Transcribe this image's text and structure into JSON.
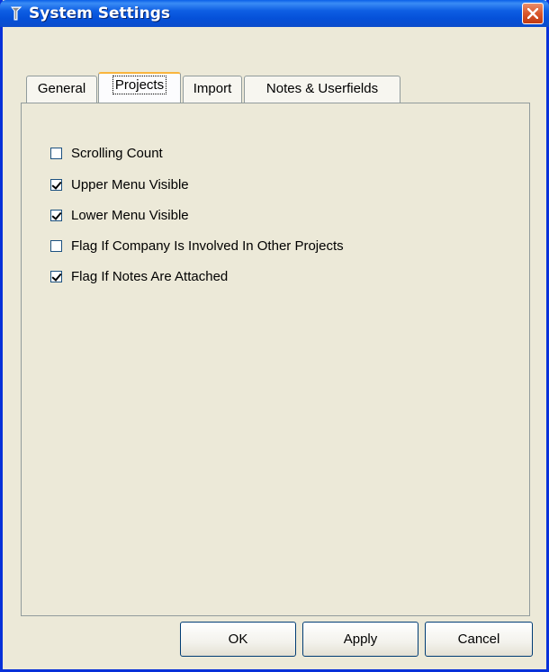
{
  "window": {
    "title": "System Settings"
  },
  "tabs": [
    {
      "label": "General",
      "active": false
    },
    {
      "label": "Projects",
      "active": true
    },
    {
      "label": "Import",
      "active": false
    },
    {
      "label": "Notes & Userfields",
      "active": false
    }
  ],
  "options": [
    {
      "label": "Scrolling Count",
      "checked": false
    },
    {
      "label": "Upper Menu Visible",
      "checked": true
    },
    {
      "label": "Lower Menu Visible",
      "checked": true
    },
    {
      "label": "Flag If Company Is Involved In Other Projects",
      "checked": false
    },
    {
      "label": "Flag If Notes Are Attached",
      "checked": true
    }
  ],
  "buttons": {
    "ok": "OK",
    "apply": "Apply",
    "cancel": "Cancel"
  },
  "colors": {
    "titlebar": "#0a5fe8",
    "close_button": "#d9572b",
    "active_tab_highlight": "#f9b53e",
    "dialog_background": "#ece9d8"
  }
}
